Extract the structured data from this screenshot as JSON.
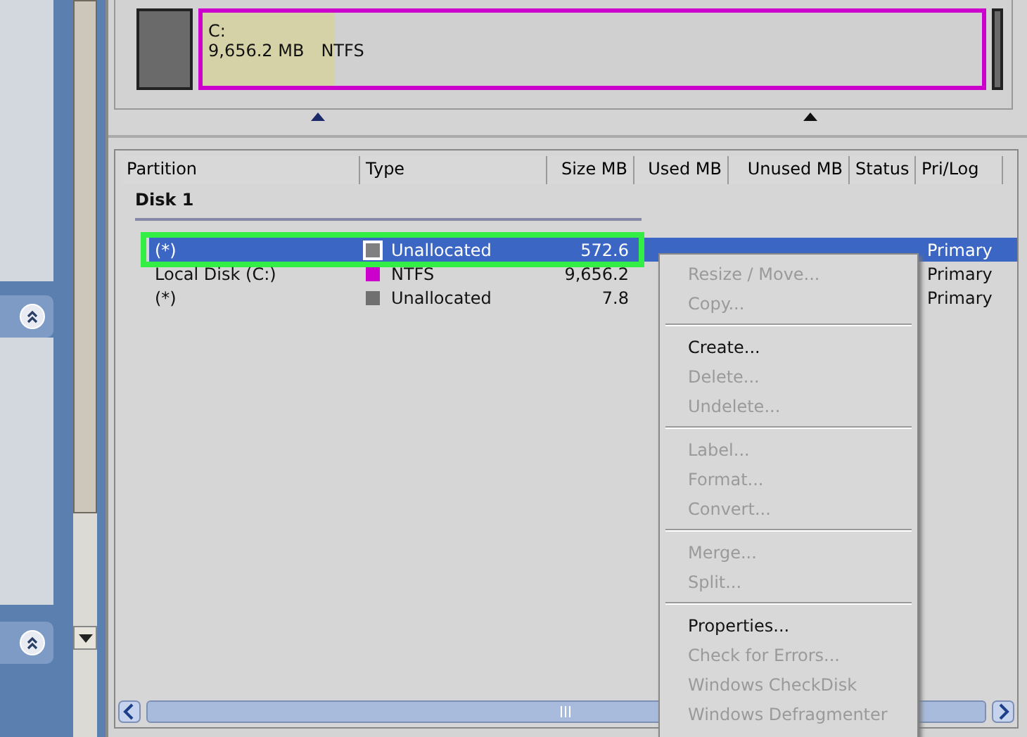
{
  "disk_map": {
    "segments": [
      {
        "kind": "unallocated",
        "selected": false
      },
      {
        "kind": "partition",
        "label": "C:",
        "size": "9,656.2 MB",
        "filesystem": "NTFS",
        "level": 0.17,
        "selected": true
      },
      {
        "kind": "unallocated",
        "selected": false
      }
    ]
  },
  "table": {
    "columns": [
      "Partition",
      "Type",
      "Size MB",
      "Used MB",
      "Unused MB",
      "Status",
      "Pri/Log"
    ],
    "disk": "Disk 1",
    "rows": [
      {
        "partition": "(*)",
        "type": "Unallocated",
        "color": "#808080",
        "size": "572.6",
        "pri_log": "Primary",
        "selected": true,
        "highlighted": true
      },
      {
        "partition": "Local Disk (C:)",
        "type": "NTFS",
        "color": "#cc00cc",
        "size": "9,656.2",
        "pri_log": "Primary",
        "selected": false,
        "highlighted": false
      },
      {
        "partition": "(*)",
        "type": "Unallocated",
        "color": "#707070",
        "size": "7.8",
        "pri_log": "Primary",
        "selected": false,
        "highlighted": false
      }
    ]
  },
  "context_menu": {
    "groups": [
      [
        {
          "label": "Resize / Move...",
          "disabled": true
        },
        {
          "label": "Copy...",
          "disabled": true
        }
      ],
      [
        {
          "label": "Create...",
          "disabled": false
        },
        {
          "label": "Delete...",
          "disabled": true
        },
        {
          "label": "Undelete...",
          "disabled": true
        }
      ],
      [
        {
          "label": "Label...",
          "disabled": true
        },
        {
          "label": "Format...",
          "disabled": true
        },
        {
          "label": "Convert...",
          "disabled": true
        }
      ],
      [
        {
          "label": "Merge...",
          "disabled": true
        },
        {
          "label": "Split...",
          "disabled": true
        }
      ],
      [
        {
          "label": "Properties...",
          "disabled": false
        },
        {
          "label": "Check for Errors...",
          "disabled": true
        },
        {
          "label": "Windows CheckDisk",
          "disabled": true
        },
        {
          "label": "Windows Defragmenter",
          "disabled": true
        }
      ]
    ]
  }
}
